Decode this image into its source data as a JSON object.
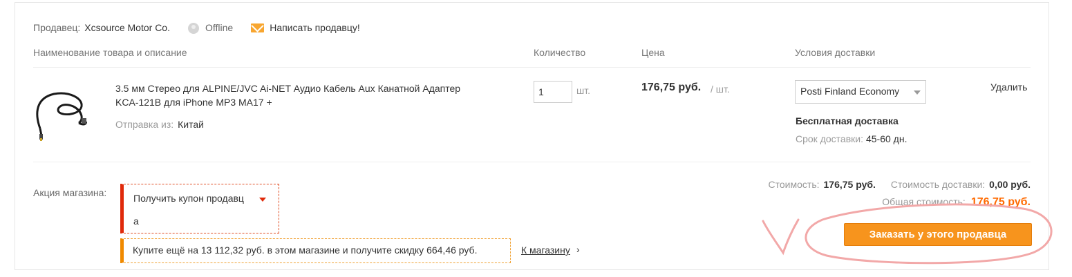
{
  "seller": {
    "label": "Продавец:",
    "name": "Xcsource Motor Co.",
    "status": "Offline",
    "message_link": "Написать продавцу!"
  },
  "headers": {
    "product": "Наименование товара и описание",
    "quantity": "Количество",
    "price": "Цена",
    "shipping": "Условия доставки"
  },
  "item": {
    "title_line1": "3.5 мм Стерео для ALPINE/JVC Ai-NET Аудио Кабель Aux Канатной Адаптер",
    "title_line2": "KCA-121B для iPhone MP3 MA17 +",
    "ship_from_label": "Отправка из:",
    "ship_from_value": "Китай",
    "quantity": "1",
    "quantity_unit": "шт.",
    "price": "176,75 руб.",
    "price_unit": "/ шт.",
    "shipping_method": "Posti Finland Economy",
    "free_shipping": "Бесплатная доставка",
    "delivery_label": "Срок доставки:",
    "delivery_value": "45-60 дн.",
    "delete": "Удалить"
  },
  "promo": {
    "label": "Акция магазина:",
    "coupon_line1": "Получить купон продавц",
    "coupon_line2": "а",
    "discount_text": "Купите ещё на 13 112,32 руб. в этом магазине и получите скидку 664,46 руб.",
    "shop_link": "К магазину",
    "shop_arrow": "›"
  },
  "summary": {
    "cost_label": "Стоимость:",
    "cost_value": "176,75 руб.",
    "shipping_label": "Стоимость доставки:",
    "shipping_value": "0,00 руб.",
    "total_label": "Общая стоимость:",
    "total_value": "176,75 руб.",
    "order_button": "Заказать у этого продавца"
  },
  "colors": {
    "accent_orange": "#f7941d",
    "total_orange": "#ff6a00",
    "coupon_red": "#e02a0a",
    "annotation_pink": "#f2a8a8"
  }
}
